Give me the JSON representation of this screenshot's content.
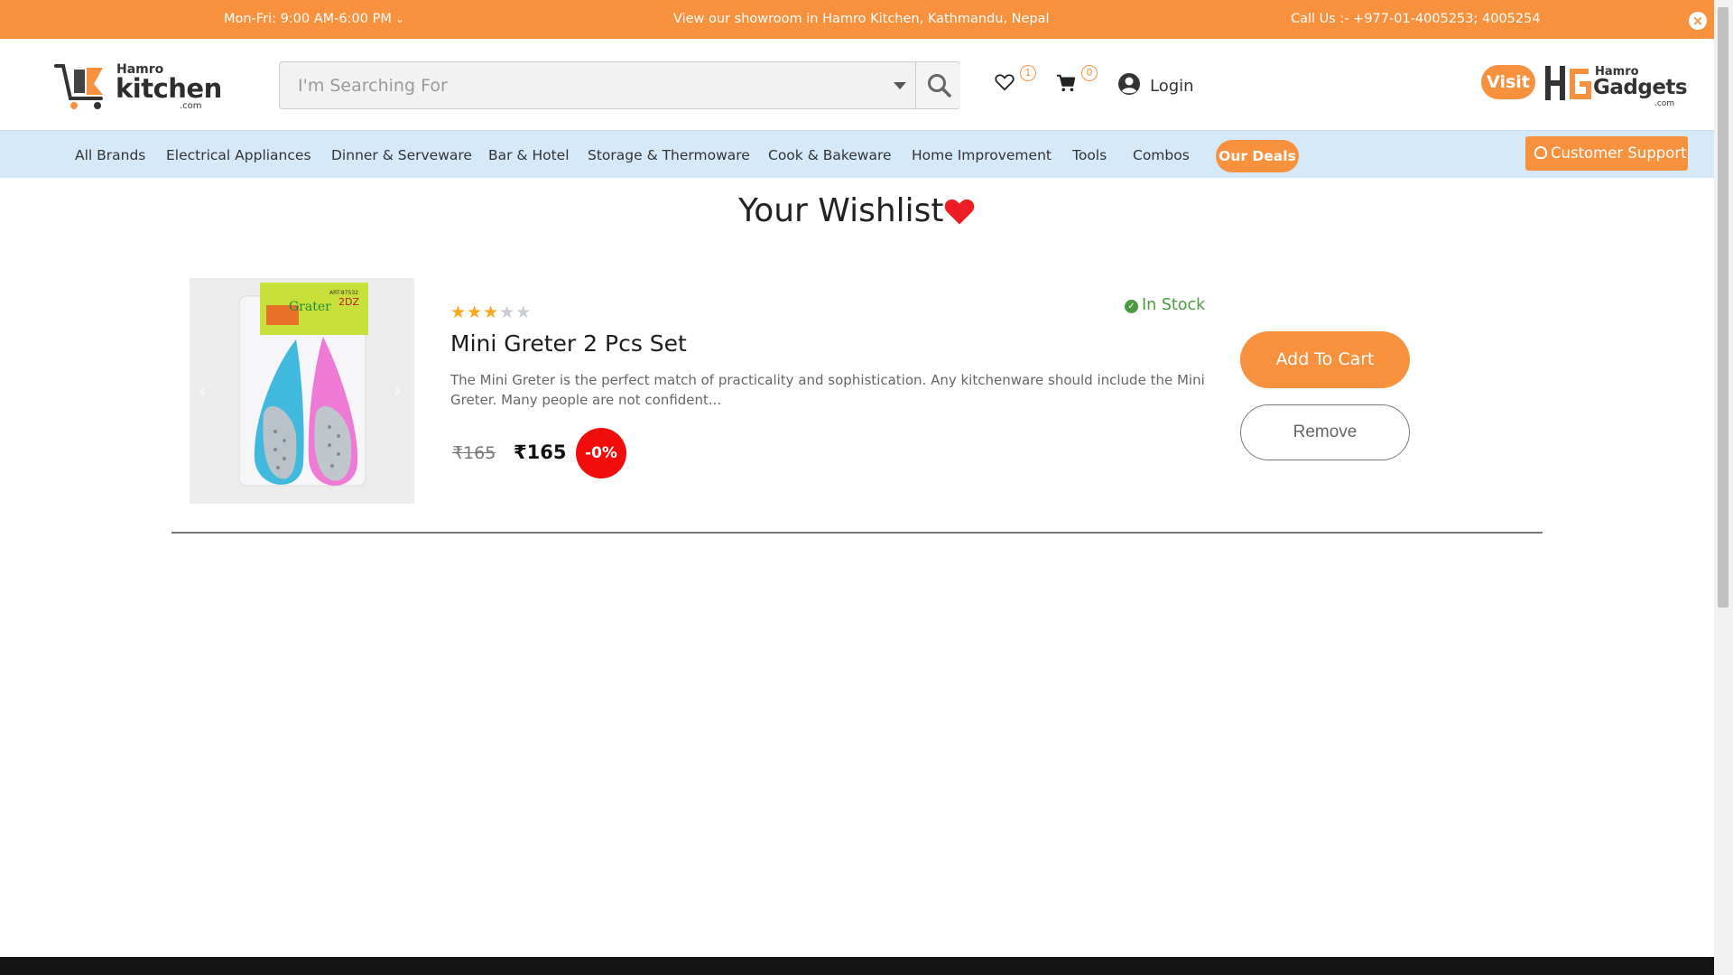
{
  "topbar": {
    "hours": "Mon-Fri: 9:00 AM-6:00 PM",
    "showroom": "View our showroom in Hamro Kitchen, Kathmandu, Nepal",
    "call": "Call Us :- +977-01-4005253; 4005254",
    "close_glyph": "×"
  },
  "header": {
    "logo": {
      "hamro": "Hamro",
      "kitchen": "kitchen",
      "com": ".com"
    },
    "search": {
      "placeholder": "I'm Searching For"
    },
    "wishlist_count": "1",
    "cart_count": "0",
    "login_label": "Login",
    "visit_label": "Visit",
    "partner": {
      "hamro": "Hamro",
      "gadgets": "Gadgets",
      "com": ".com"
    }
  },
  "nav": {
    "items": [
      "All Brands",
      "Electrical Appliances",
      "Dinner & Serveware",
      "Bar & Hotel",
      "Storage & Thermoware",
      "Cook & Bakeware",
      "Home Improvement",
      "Tools",
      "Combos"
    ],
    "deals_label": "Our Deals",
    "support_label": "Customer Support"
  },
  "page": {
    "title": "Your Wishlist"
  },
  "wishlist": [
    {
      "rating": 3,
      "rating_max": 5,
      "stock": "In Stock",
      "name": "Mini Greter 2 Pcs Set",
      "description": "The Mini Greter is the perfect match of practicality and sophistication. Any kitchenware should include the Mini Greter. Many people are not confident...",
      "old_price": "₹165",
      "price": "₹165",
      "discount": "-0%",
      "add_to_cart_label": "Add To Cart",
      "remove_label": "Remove",
      "image_text": {
        "brand": "Grater",
        "code": "2DZ",
        "art": "ART:87532"
      }
    }
  ],
  "colors": {
    "accent": "#f7913d",
    "nav_bg": "#d6e9f8",
    "stock_green": "#4b9a40",
    "discount_red": "#f20c0c",
    "heart_red": "#ee1c25"
  }
}
